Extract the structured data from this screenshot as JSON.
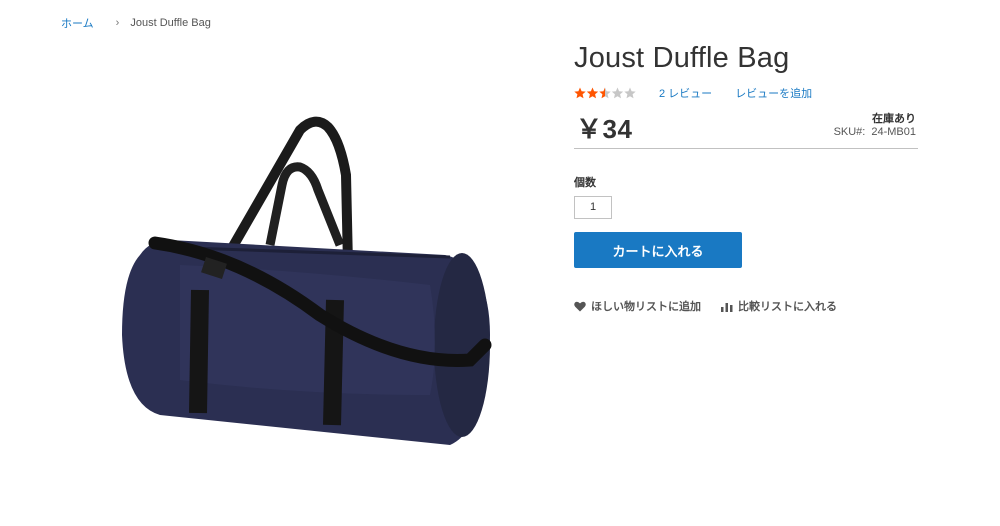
{
  "breadcrumb": {
    "home": "ホーム",
    "separator": "›",
    "current": "Joust Duffle Bag"
  },
  "product": {
    "title": "Joust Duffle Bag",
    "rating_value": 2.5,
    "rating_max": 5,
    "review_count_label": "2 レビュー",
    "add_review_label": "レビューを追加",
    "price": "￥34",
    "stock": "在庫あり",
    "sku_label": "SKU#:",
    "sku_value": "24-MB01",
    "image_alt": "Joust Duffle Bag"
  },
  "purchase": {
    "qty_label": "個数",
    "qty_value": "1",
    "add_to_cart_label": "カートに入れる"
  },
  "actions": {
    "wishlist_label": "ほしい物リストに追加",
    "compare_label": "比較リストに入れる"
  },
  "icons": {
    "wishlist": "heart-icon",
    "compare": "bar-chart-icon"
  },
  "colors": {
    "link": "#1979c3",
    "button": "#1979c3",
    "star_filled": "#ff5501",
    "star_empty": "#c7c7c7"
  }
}
